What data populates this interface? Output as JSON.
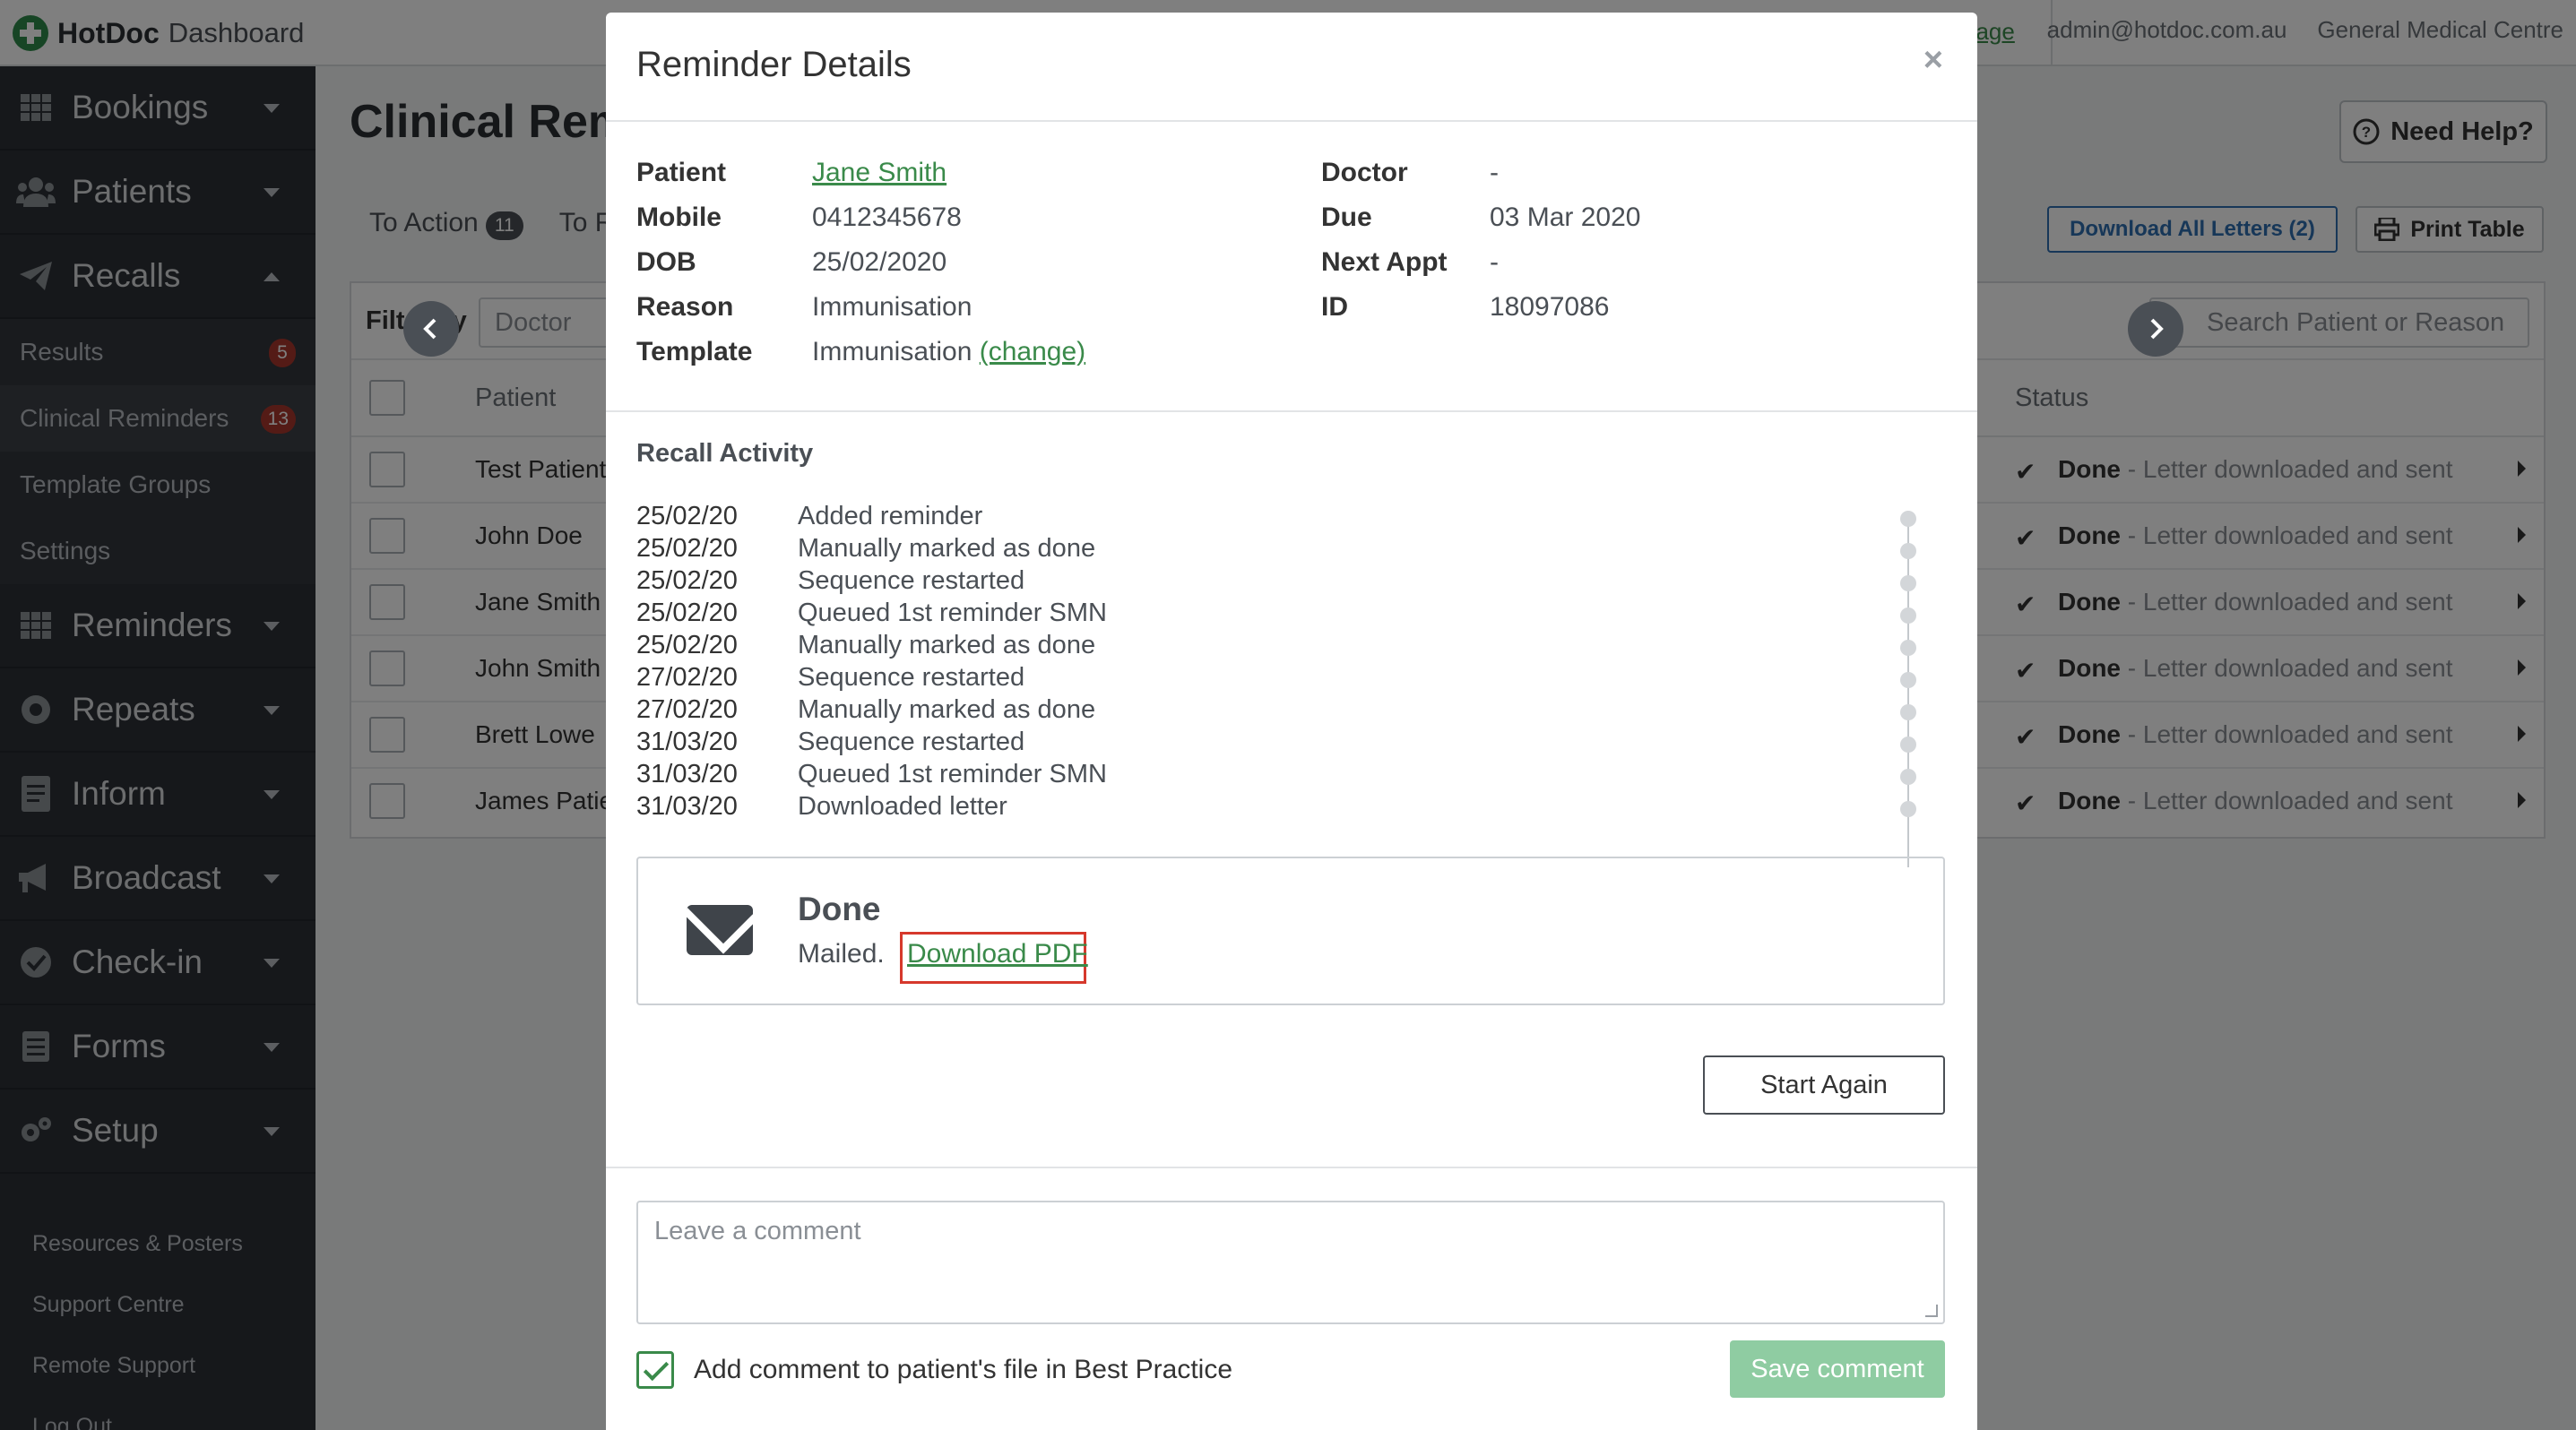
{
  "app": {
    "brand": "HotDoc",
    "brand_sub": "Dashboard",
    "top_link": "page",
    "user_email": "admin@hotdoc.com.au",
    "clinic": "General Medical Centre"
  },
  "sidebar": {
    "sections": [
      {
        "label": "Bookings",
        "icon": "calendar-grid-icon"
      },
      {
        "label": "Patients",
        "icon": "users-icon"
      },
      {
        "label": "Recalls",
        "icon": "paper-plane-icon"
      }
    ],
    "recalls_sub": [
      {
        "label": "Results",
        "badge": "5"
      },
      {
        "label": "Clinical Reminders",
        "badge": "13"
      },
      {
        "label": "Template Groups"
      },
      {
        "label": "Settings"
      }
    ],
    "sections_after": [
      {
        "label": "Reminders",
        "icon": "calendar-grid-icon"
      },
      {
        "label": "Repeats",
        "icon": "pill-icon"
      },
      {
        "label": "Inform",
        "icon": "document-icon"
      },
      {
        "label": "Broadcast",
        "icon": "megaphone-icon"
      },
      {
        "label": "Check-in",
        "icon": "check-circle-icon"
      },
      {
        "label": "Forms",
        "icon": "list-icon"
      },
      {
        "label": "Setup",
        "icon": "gears-icon"
      }
    ],
    "links": [
      "Resources & Posters",
      "Support Centre",
      "Remote Support",
      "Log Out"
    ]
  },
  "main": {
    "title": "Clinical Remi",
    "need_help": "Need Help?",
    "tabs": [
      {
        "label": "To Action",
        "badge": "11"
      },
      {
        "label": "To R"
      }
    ],
    "download_all": "Download All Letters (2)",
    "print_table": "Print Table",
    "filter_label": "Filter by",
    "doctor_placeholder": "Doctor",
    "search_placeholder": "Search Patient or Reason",
    "columns": {
      "patient": "Patient",
      "status": "Status"
    },
    "rows": [
      {
        "patient": "Test Patient",
        "status_bold": "Done",
        "status_text": " - Letter downloaded and sent"
      },
      {
        "patient": "John Doe",
        "status_bold": "Done",
        "status_text": " - Letter downloaded and sent"
      },
      {
        "patient": "Jane Smith",
        "status_bold": "Done",
        "status_text": " - Letter downloaded and sent"
      },
      {
        "patient": "John Smith",
        "status_bold": "Done",
        "status_text": " - Letter downloaded and sent"
      },
      {
        "patient": "Brett Lowe",
        "status_bold": "Done",
        "status_text": " - Letter downloaded and sent"
      },
      {
        "patient": "James Patien",
        "status_bold": "Done",
        "status_text": " - Letter downloaded and sent"
      }
    ]
  },
  "modal": {
    "title": "Reminder Details",
    "close": "×",
    "labels": {
      "patient": "Patient",
      "mobile": "Mobile",
      "dob": "DOB",
      "reason": "Reason",
      "template": "Template",
      "doctor": "Doctor",
      "due": "Due",
      "next_appt": "Next Appt",
      "id": "ID"
    },
    "values": {
      "patient": "Jane Smith",
      "mobile": "0412345678",
      "dob": "25/02/2020",
      "reason": "Immunisation",
      "template": "Immunisation",
      "template_change": "(change)",
      "doctor": "-",
      "due": "03 Mar 2020",
      "next_appt": "-",
      "id": "18097086"
    },
    "activity_title": "Recall Activity",
    "activity": [
      {
        "date": "25/02/20",
        "text": "Added reminder"
      },
      {
        "date": "25/02/20",
        "text": "Manually marked as done"
      },
      {
        "date": "25/02/20",
        "text": "Sequence restarted"
      },
      {
        "date": "25/02/20",
        "text": "Queued 1st reminder SMN"
      },
      {
        "date": "25/02/20",
        "text": "Manually marked as done"
      },
      {
        "date": "27/02/20",
        "text": "Sequence restarted"
      },
      {
        "date": "27/02/20",
        "text": "Manually marked as done"
      },
      {
        "date": "31/03/20",
        "text": "Sequence restarted"
      },
      {
        "date": "31/03/20",
        "text": "Queued 1st reminder SMN"
      },
      {
        "date": "31/03/20",
        "text": "Downloaded letter"
      }
    ],
    "done_title": "Done",
    "done_prefix": "Mailed.",
    "download_pdf": "Download PDF",
    "start_again": "Start Again",
    "comment_placeholder": "Leave a comment",
    "add_comment_label": "Add comment to patient's file in Best Practice",
    "save_comment": "Save comment"
  },
  "colors": {
    "accent_green": "#3a8a4a",
    "highlight_red": "#d6382c",
    "sidebar_bg": "#2c3036",
    "badge_red": "#a8372c",
    "primary_blue": "#2f6fb0"
  }
}
